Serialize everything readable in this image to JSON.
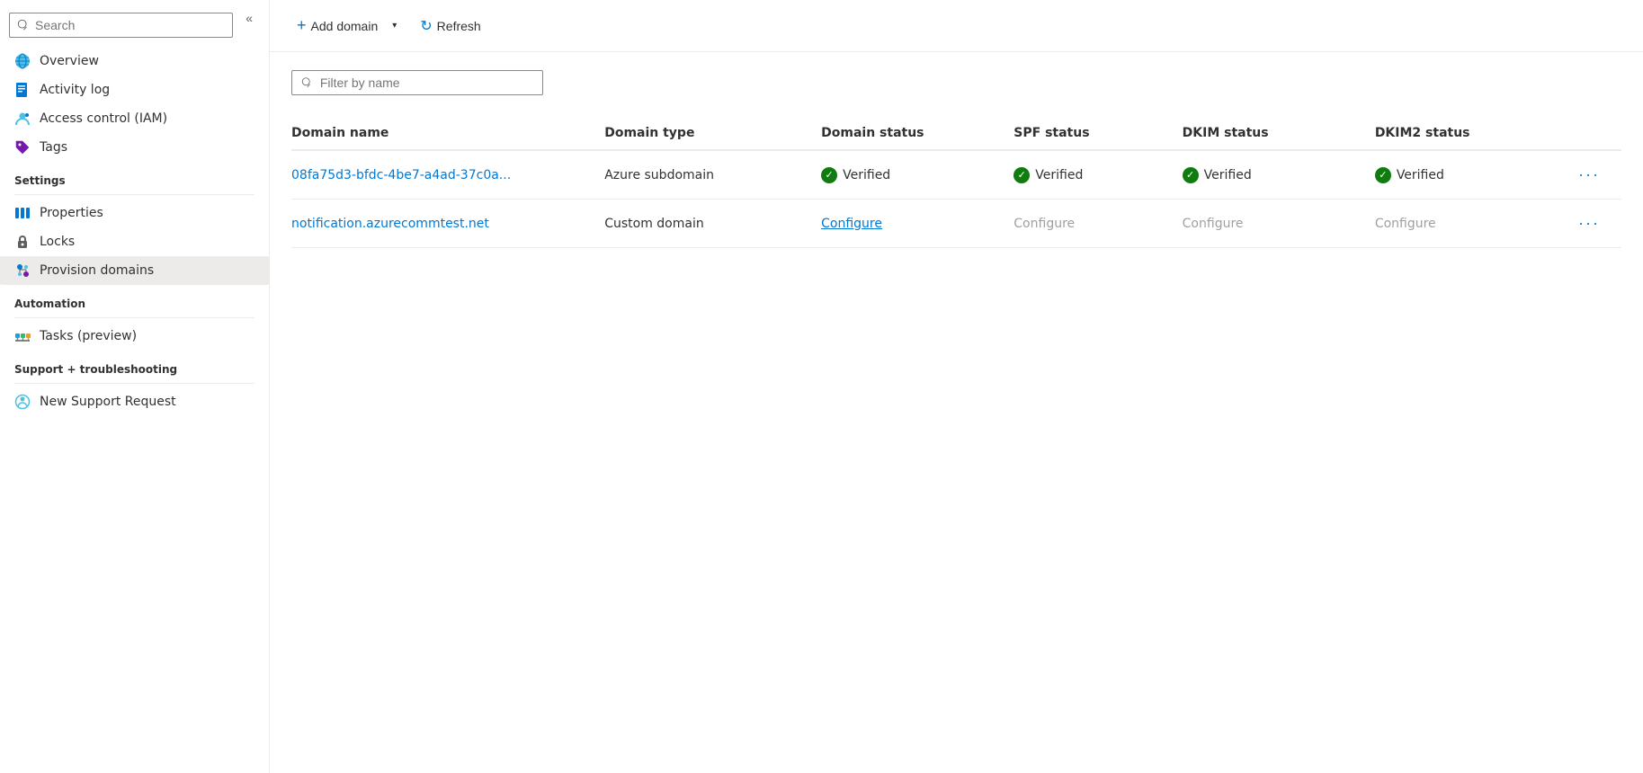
{
  "sidebar": {
    "search_placeholder": "Search",
    "collapse_label": "«",
    "nav_items": [
      {
        "id": "overview",
        "label": "Overview",
        "icon": "globe-icon"
      },
      {
        "id": "activity-log",
        "label": "Activity log",
        "icon": "log-icon"
      },
      {
        "id": "access-control",
        "label": "Access control (IAM)",
        "icon": "iam-icon"
      },
      {
        "id": "tags",
        "label": "Tags",
        "icon": "tag-icon"
      }
    ],
    "sections": [
      {
        "header": "Settings",
        "items": [
          {
            "id": "properties",
            "label": "Properties",
            "icon": "properties-icon"
          },
          {
            "id": "locks",
            "label": "Locks",
            "icon": "lock-icon"
          },
          {
            "id": "provision-domains",
            "label": "Provision domains",
            "icon": "provision-icon",
            "active": true
          }
        ]
      },
      {
        "header": "Automation",
        "items": [
          {
            "id": "tasks",
            "label": "Tasks (preview)",
            "icon": "tasks-icon"
          }
        ]
      },
      {
        "header": "Support + troubleshooting",
        "items": [
          {
            "id": "new-support",
            "label": "New Support Request",
            "icon": "support-icon"
          }
        ]
      }
    ]
  },
  "toolbar": {
    "add_domain_label": "Add domain",
    "add_domain_dropdown": true,
    "refresh_label": "Refresh"
  },
  "filter": {
    "placeholder": "Filter by name"
  },
  "table": {
    "columns": [
      "Domain name",
      "Domain type",
      "Domain status",
      "SPF status",
      "DKIM status",
      "DKIM2 status"
    ],
    "rows": [
      {
        "id": "row1",
        "domain_name": "08fa75d3-bfdc-4be7-a4ad-37c0a...",
        "domain_type": "Azure subdomain",
        "domain_status": "Verified",
        "domain_status_type": "verified",
        "spf_status": "Verified",
        "spf_status_type": "verified",
        "dkim_status": "Verified",
        "dkim_status_type": "verified",
        "dkim2_status": "Verified",
        "dkim2_status_type": "verified"
      },
      {
        "id": "row2",
        "domain_name": "notification.azurecommtest.net",
        "domain_type": "Custom domain",
        "domain_status": "Configure",
        "domain_status_type": "configure-link",
        "spf_status": "Configure",
        "spf_status_type": "configure-gray",
        "dkim_status": "Configure",
        "dkim_status_type": "configure-gray",
        "dkim2_status": "Configure",
        "dkim2_status_type": "configure-gray"
      }
    ]
  },
  "colors": {
    "accent": "#0078d4",
    "verified_green": "#107c10",
    "configure_gray": "#a19f9d",
    "link": "#0078d4"
  }
}
